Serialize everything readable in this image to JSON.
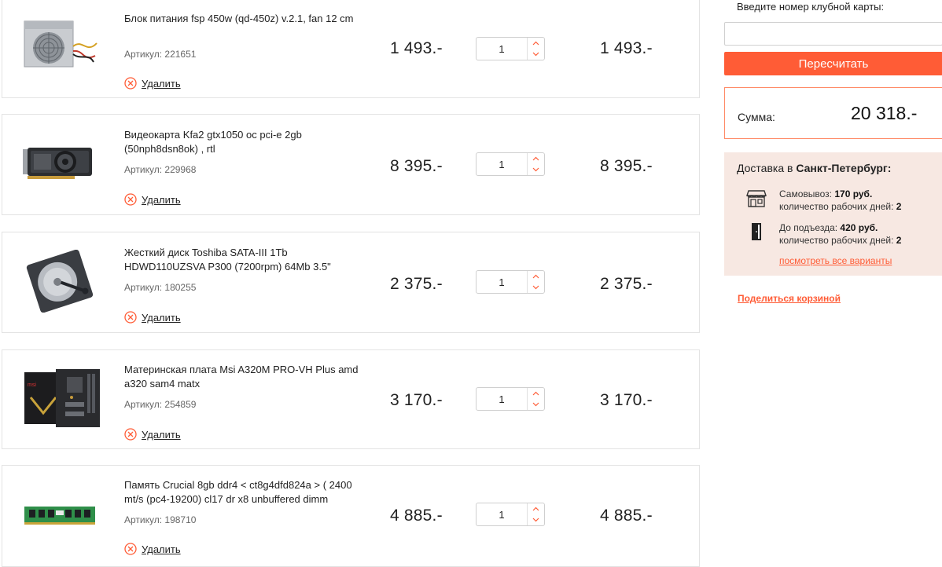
{
  "cart": {
    "items": [
      {
        "name": "Блок питания fsp 450w (qd-450z) v.2.1, fan 12 cm",
        "sku": "Артикул: 221651",
        "price": "1 493.-",
        "qty": "1",
        "total": "1 493.-",
        "remove_label": "Удалить"
      },
      {
        "name": "Видеокарта Kfa2 gtx1050 oc pci-e 2gb (50nph8dsn8ok) , rtl",
        "sku": "Артикул: 229968",
        "price": "8 395.-",
        "qty": "1",
        "total": "8 395.-",
        "remove_label": "Удалить"
      },
      {
        "name": "Жесткий диск Toshiba SATA-III 1Tb HDWD110UZSVA P300 (7200rpm) 64Mb 3.5\"",
        "sku": "Артикул: 180255",
        "price": "2 375.-",
        "qty": "1",
        "total": "2 375.-",
        "remove_label": "Удалить"
      },
      {
        "name": "Материнская плата Msi A320M PRO-VH Plus amd a320 sam4 matx",
        "sku": "Артикул: 254859",
        "price": "3 170.-",
        "qty": "1",
        "total": "3 170.-",
        "remove_label": "Удалить"
      },
      {
        "name": "Память Crucial 8gb ddr4 < ct8g4dfd824a > ( 2400 mt/s (pc4-19200) cl17 dr x8 unbuffered dimm",
        "sku": "Артикул: 198710",
        "price": "4 885.-",
        "qty": "1",
        "total": "4 885.-",
        "remove_label": "Удалить"
      }
    ]
  },
  "sidebar": {
    "club_card_label": "Введите номер клубной карты:",
    "club_card_value": "",
    "recalc_label": "Пересчитать",
    "sum_label": "Сумма:",
    "sum_value": "20 318.-",
    "delivery": {
      "title_prefix": "Доставка в",
      "city": "Санкт-Петербург:",
      "options": [
        {
          "icon": "store-icon",
          "label": "Самовывоз:",
          "price": "170 руб.",
          "days_label": "количество рабочих дней:",
          "days": "2"
        },
        {
          "icon": "door-icon",
          "label": "До подъезда:",
          "price": "420 руб.",
          "days_label": "количество рабочих дней:",
          "days": "2"
        }
      ],
      "see_all": "посмотреть все варианты"
    },
    "share_label": "Поделиться корзиной"
  },
  "colors": {
    "accent": "#ff5c36",
    "delivery_bg": "#f7e8e2",
    "border": "#e3e3e3"
  }
}
